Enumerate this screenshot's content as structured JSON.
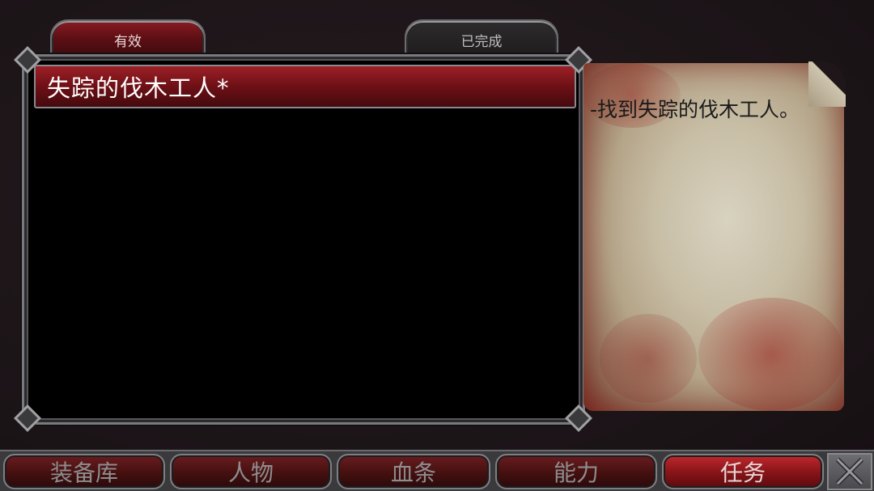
{
  "tabs": {
    "active_label": "有效",
    "completed_label": "已完成"
  },
  "quest_list": {
    "items": [
      {
        "title": "失踪的伐木工人*"
      }
    ]
  },
  "quest_detail": {
    "description": "-找到失踪的伐木工人。"
  },
  "bottom_nav": {
    "items": [
      {
        "label": "装备库"
      },
      {
        "label": "人物"
      },
      {
        "label": "血条"
      },
      {
        "label": "能力"
      },
      {
        "label": "任务",
        "active": true
      }
    ]
  },
  "colors": {
    "accent_red": "#8a1519",
    "frame_grey": "#7a7a7e",
    "background": "#1e1619"
  },
  "icons": {
    "close": "close-x-icon"
  }
}
